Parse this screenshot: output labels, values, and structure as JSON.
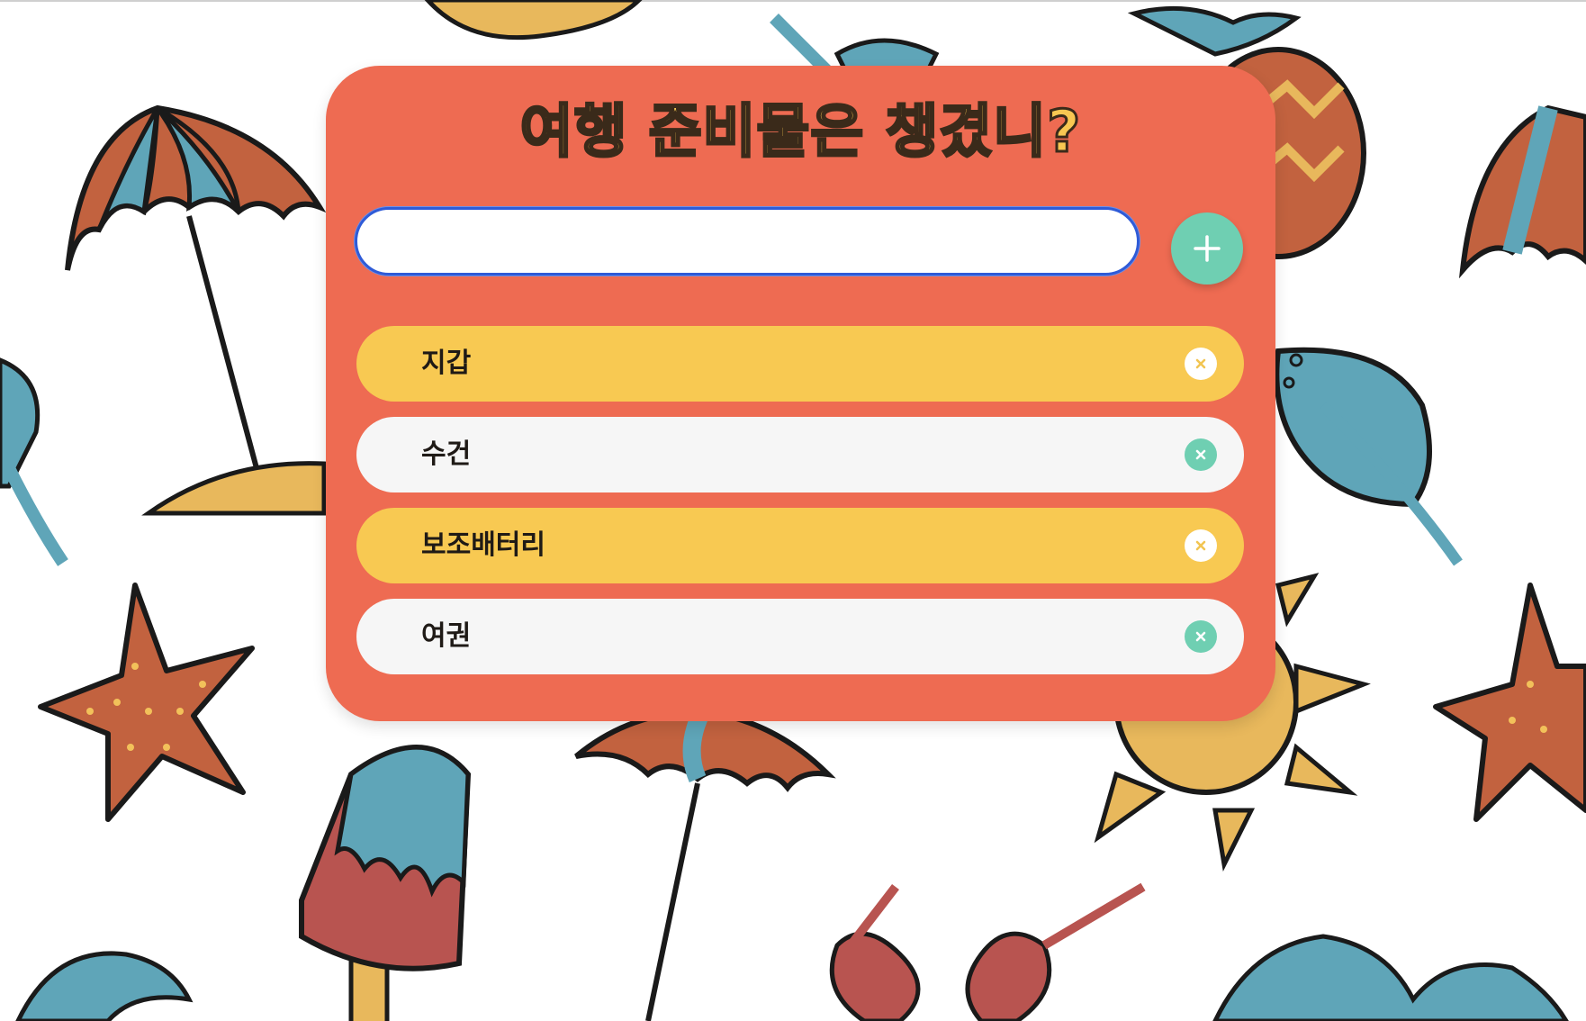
{
  "page": {
    "title": "여행 준비물은 챙겼니?",
    "background_pattern": [
      "umbrella-icon",
      "starfish-icon",
      "leaf-icon",
      "pineapple-icon",
      "sun-icon",
      "popsicle-icon",
      "sunglasses-icon",
      "palm-icon"
    ]
  },
  "input": {
    "value": "",
    "placeholder": ""
  },
  "add_button": {
    "icon": "plus-icon"
  },
  "items": [
    {
      "label": "지갑",
      "style": "yellow"
    },
    {
      "label": "수건",
      "style": "white"
    },
    {
      "label": "보조배터리",
      "style": "yellow"
    },
    {
      "label": "여권",
      "style": "white"
    }
  ],
  "colors": {
    "card": "#ee6b52",
    "title": "#f8c752",
    "item_yellow": "#f8c952",
    "item_white": "#f6f6f6",
    "accent_mint": "#6fcfb2",
    "input_focus": "#2f5bd7"
  }
}
